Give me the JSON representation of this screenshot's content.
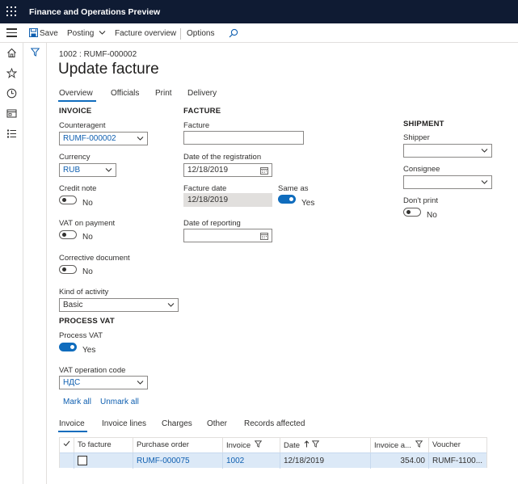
{
  "app": {
    "title": "Finance and Operations Preview"
  },
  "toolbar": {
    "save_label": "Save",
    "posting_label": "Posting",
    "facture_overview_label": "Facture overview",
    "options_label": "Options"
  },
  "page": {
    "breadcrumb": "1002 : RUMF-000002",
    "title": "Update facture"
  },
  "tabs": [
    {
      "label": "Overview",
      "active": true
    },
    {
      "label": "Officials"
    },
    {
      "label": "Print"
    },
    {
      "label": "Delivery"
    }
  ],
  "invoice": {
    "heading": "INVOICE",
    "counteragent": {
      "label": "Counteragent",
      "value": "RUMF-000002"
    },
    "currency": {
      "label": "Currency",
      "value": "RUB"
    },
    "credit_note": {
      "label": "Credit note",
      "state": "No"
    },
    "vat_on_payment": {
      "label": "VAT on payment",
      "state": "No"
    },
    "corrective_document": {
      "label": "Corrective document",
      "state": "No"
    },
    "kind_of_activity": {
      "label": "Kind of activity",
      "value": "Basic"
    }
  },
  "process_vat": {
    "heading": "PROCESS VAT",
    "process_vat": {
      "label": "Process VAT",
      "state": "Yes"
    },
    "vat_operation_code": {
      "label": "VAT operation code",
      "value": "НДС"
    },
    "mark_all": "Mark all",
    "unmark_all": "Unmark all"
  },
  "facture": {
    "heading": "FACTURE",
    "facture": {
      "label": "Facture",
      "value": ""
    },
    "date_of_registration": {
      "label": "Date of the registration",
      "value": "12/18/2019"
    },
    "facture_date": {
      "label": "Facture date",
      "value": "12/18/2019"
    },
    "same_as": {
      "label": "Same as",
      "state": "Yes"
    },
    "date_of_reporting": {
      "label": "Date of reporting",
      "value": ""
    }
  },
  "shipment": {
    "heading": "SHIPMENT",
    "shipper": {
      "label": "Shipper",
      "value": ""
    },
    "consignee": {
      "label": "Consignee",
      "value": ""
    },
    "dont_print": {
      "label": "Don't print",
      "state": "No"
    }
  },
  "bottom_tabs": [
    {
      "label": "Invoice",
      "active": true
    },
    {
      "label": "Invoice lines"
    },
    {
      "label": "Charges"
    },
    {
      "label": "Other"
    },
    {
      "label": "Records affected"
    }
  ],
  "grid": {
    "columns": [
      "To facture",
      "Purchase order",
      "Invoice",
      "Date",
      "Invoice a...",
      "Voucher"
    ],
    "rows": [
      {
        "purchase_order": "RUMF-000075",
        "invoice": "1002",
        "date": "12/18/2019",
        "amount": "354.00",
        "voucher": "RUMF-1100..."
      }
    ]
  },
  "colors": {
    "topbar": "#0f1b33",
    "accent": "#0f6cbd",
    "link": "#0f5fb0",
    "selected_row": "#dce9f7"
  }
}
